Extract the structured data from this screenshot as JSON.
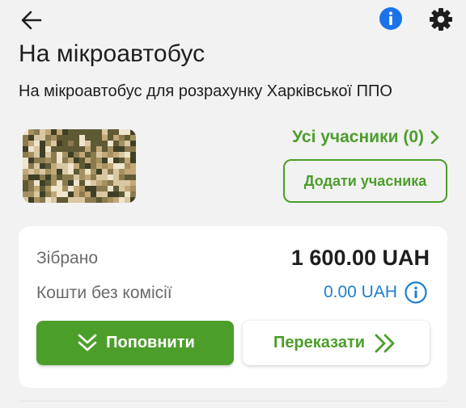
{
  "header": {
    "back_icon": "arrow-left-icon",
    "info_icon": "info-filled-icon",
    "settings_icon": "gear-icon",
    "accent_blue": "#1a73e8"
  },
  "jar": {
    "title": "На мікроавтобус",
    "description": "На мікроавтобус для розрахунку Харківської ППО",
    "cover_image": "digital-camouflage-pattern"
  },
  "participants": {
    "link_label": "Усі учасники (0)",
    "link_icon": "chevron-right-icon",
    "add_button_label": "Додати учасника"
  },
  "stats": {
    "collected_label": "Зібрано",
    "collected_value": "1 600.00 UAH",
    "no_commission_label": "Кошти без комісії",
    "no_commission_value": "0.00 UAH",
    "no_commission_icon": "info-outline-icon"
  },
  "actions": {
    "topup_label": "Поповнити",
    "topup_icon": "double-chevron-down-icon",
    "transfer_label": "Переказати",
    "transfer_icon": "double-chevron-right-icon"
  },
  "colors": {
    "brand_green": "#4c9e2a",
    "link_blue": "#1f7fd1",
    "background": "#f2f2f2",
    "card": "#ffffff"
  }
}
